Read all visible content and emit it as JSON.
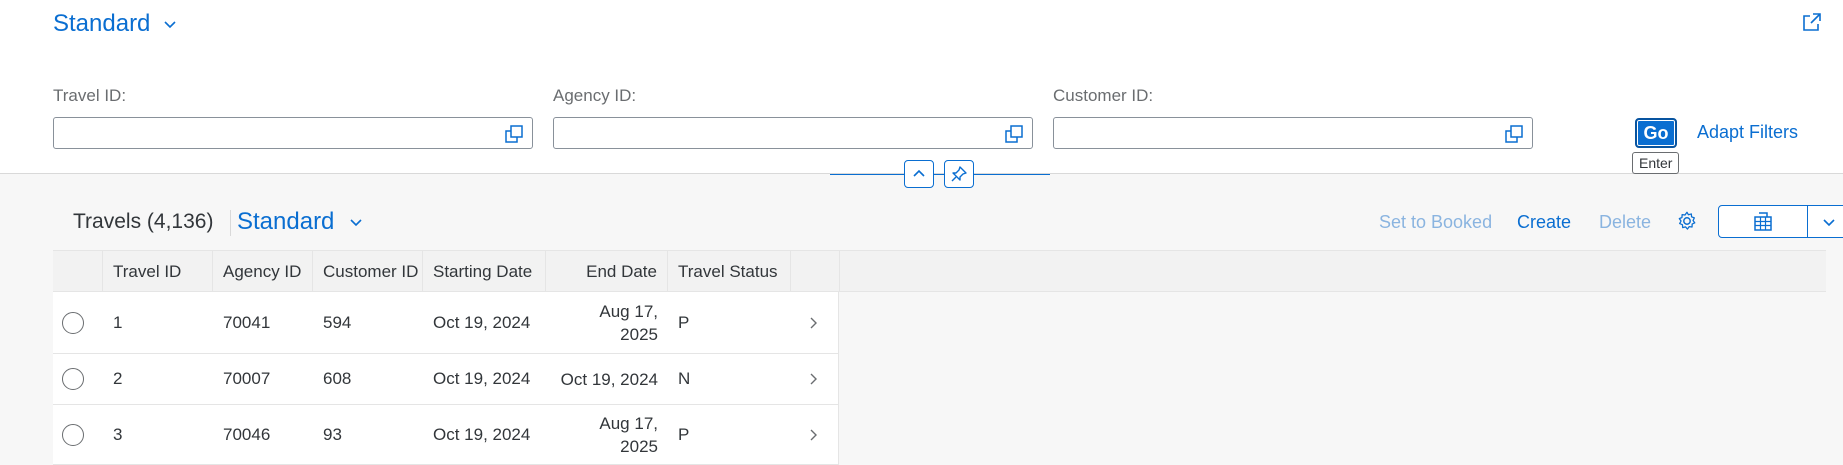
{
  "header": {
    "variant": "Standard",
    "filters": [
      {
        "label": "Travel ID:",
        "value": "",
        "placeholder": ""
      },
      {
        "label": "Agency ID:",
        "value": "",
        "placeholder": ""
      },
      {
        "label": "Customer ID:",
        "value": "",
        "placeholder": ""
      }
    ],
    "go_label": "Go",
    "go_tooltip": "Enter",
    "adapt_filters_label": "Adapt Filters"
  },
  "table": {
    "title": "Travels (4,136)",
    "variant": "Standard",
    "actions": {
      "set_to_booked": "Set to Booked",
      "create": "Create",
      "delete": "Delete"
    },
    "columns": [
      "Travel ID",
      "Agency ID",
      "Customer ID",
      "Starting Date",
      "End Date",
      "Travel Status"
    ],
    "rows": [
      {
        "travel_id": "1",
        "agency_id": "70041",
        "customer_id": "594",
        "start": "Oct 19, 2024",
        "end_line1": "Aug 17,",
        "end_line2": "2025",
        "status": "P"
      },
      {
        "travel_id": "2",
        "agency_id": "70007",
        "customer_id": "608",
        "start": "Oct 19, 2024",
        "end_line1": "Oct 19, 2024",
        "end_line2": "",
        "status": "N"
      },
      {
        "travel_id": "3",
        "agency_id": "70046",
        "customer_id": "93",
        "start": "Oct 19, 2024",
        "end_line1": "Aug 17,",
        "end_line2": "2025",
        "status": "P"
      }
    ]
  },
  "colors": {
    "accent": "#0a6ed1",
    "disabled_action": "#8ab4e0",
    "text": "#32363a",
    "label": "#6a6d70"
  },
  "icons": {
    "variant_chevron": "chevron-down-icon",
    "share": "share-icon",
    "value_help": "value-help-icon",
    "collapse": "chevron-up-icon",
    "pin": "pin-icon",
    "settings": "gear-icon",
    "export": "export-spreadsheet-icon",
    "export_menu": "chevron-down-icon",
    "row_nav": "chevron-right-icon"
  }
}
